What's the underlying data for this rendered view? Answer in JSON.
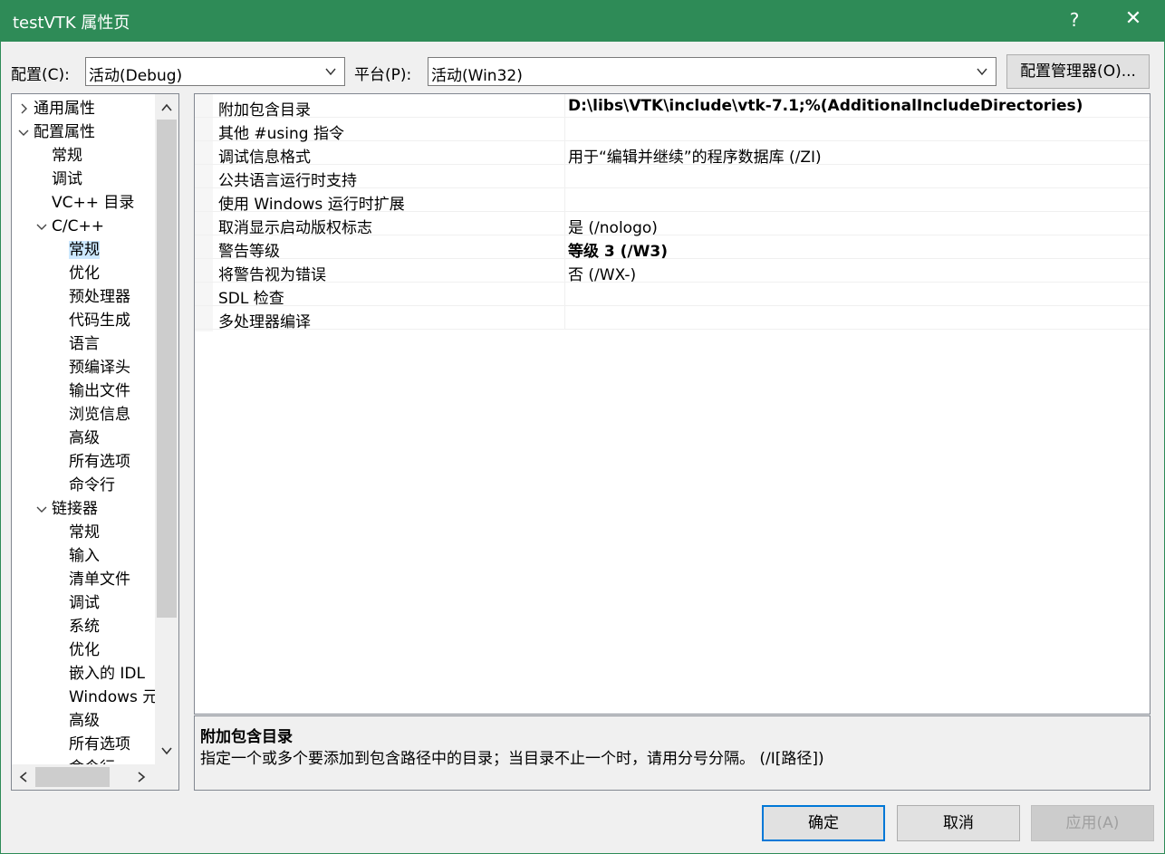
{
  "window": {
    "title": "testVTK 属性页",
    "help": "?",
    "close": "✕"
  },
  "config": {
    "label": "配置(C):",
    "value": "活动(Debug)"
  },
  "platform": {
    "label": "平台(P):",
    "value": "活动(Win32)"
  },
  "config_manager": "配置管理器(O)...",
  "tree": [
    {
      "label": "通用属性",
      "expander": "collapsed"
    },
    {
      "label": "配置属性",
      "expander": "expanded"
    },
    {
      "label": "常规"
    },
    {
      "label": "调试"
    },
    {
      "label": "VC++ 目录"
    },
    {
      "label": "C/C++",
      "expander": "expanded"
    },
    {
      "label": "常规",
      "selected": true
    },
    {
      "label": "优化"
    },
    {
      "label": "预处理器"
    },
    {
      "label": "代码生成"
    },
    {
      "label": "语言"
    },
    {
      "label": "预编译头"
    },
    {
      "label": "输出文件"
    },
    {
      "label": "浏览信息"
    },
    {
      "label": "高级"
    },
    {
      "label": "所有选项"
    },
    {
      "label": "命令行"
    },
    {
      "label": "链接器",
      "expander": "expanded"
    },
    {
      "label": "常规"
    },
    {
      "label": "输入"
    },
    {
      "label": "清单文件"
    },
    {
      "label": "调试"
    },
    {
      "label": "系统"
    },
    {
      "label": "优化"
    },
    {
      "label": "嵌入的 IDL"
    },
    {
      "label": "Windows 元数据"
    },
    {
      "label": "高级"
    },
    {
      "label": "所有选项"
    },
    {
      "label": "命令行"
    }
  ],
  "properties": [
    {
      "name": "附加包含目录",
      "value": "D:\\libs\\VTK\\include\\vtk-7.1;%(AdditionalIncludeDirectories)",
      "bold": true
    },
    {
      "name": "其他 #using 指令",
      "value": ""
    },
    {
      "name": "调试信息格式",
      "value": "用于“编辑并继续”的程序数据库 (/ZI)"
    },
    {
      "name": "公共语言运行时支持",
      "value": ""
    },
    {
      "name": "使用 Windows 运行时扩展",
      "value": ""
    },
    {
      "name": "取消显示启动版权标志",
      "value": "是 (/nologo)"
    },
    {
      "name": "警告等级",
      "value": "等级 3 (/W3)",
      "bold": true
    },
    {
      "name": "将警告视为错误",
      "value": "否 (/WX-)"
    },
    {
      "name": "SDL 检查",
      "value": ""
    },
    {
      "name": "多处理器编译",
      "value": ""
    }
  ],
  "description": {
    "title": "附加包含目录",
    "text": "指定一个或多个要添加到包含路径中的目录；当目录不止一个时，请用分号分隔。     (/I[路径])"
  },
  "buttons": {
    "ok": "确定",
    "cancel": "取消",
    "apply": "应用(A)"
  }
}
